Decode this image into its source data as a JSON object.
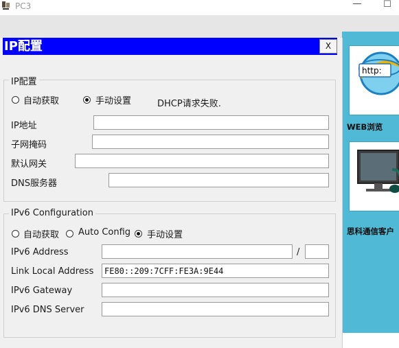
{
  "window": {
    "title": "PC3",
    "minimize_glyph": "—",
    "maximize_glyph": "☐"
  },
  "dialog": {
    "title": "IP配置",
    "close_label": "X",
    "ipv4": {
      "legend": "IP配置",
      "mode_options": [
        {
          "label": "自动获取",
          "selected": false
        },
        {
          "label": "手动设置",
          "selected": true
        }
      ],
      "dhcp_status": "DHCP请求失败.",
      "fields": {
        "ip_label": "IP地址",
        "ip_value": "",
        "mask_label": "子网掩码",
        "mask_value": "",
        "gateway_label": "默认网关",
        "gateway_value": "",
        "dns_label": "DNS服务器",
        "dns_value": ""
      }
    },
    "ipv6": {
      "legend": "IPv6 Configuration",
      "mode_options": [
        {
          "label": "自动获取",
          "selected": false
        },
        {
          "label": "Auto Config",
          "selected": false
        },
        {
          "label": "手动设置",
          "selected": true
        }
      ],
      "fields": {
        "address_label": "IPv6 Address",
        "address_value": "",
        "prefix_separator": "/",
        "prefix_value": "",
        "link_local_label": "Link Local Address",
        "link_local_value": "FE80::209:7CFF:FE3A:9E44",
        "gateway_label": "IPv6 Gateway",
        "gateway_value": "",
        "dns_label": "IPv6 DNS Server",
        "dns_value": ""
      }
    }
  },
  "desktop": {
    "web_browser_label": "WEB浏览",
    "web_browser_badge": "http:",
    "cisco_client_label": "思科通信客户"
  },
  "colors": {
    "dialog_title_bg": "#0000ff",
    "desktop_bg": "#4fb9d6"
  }
}
